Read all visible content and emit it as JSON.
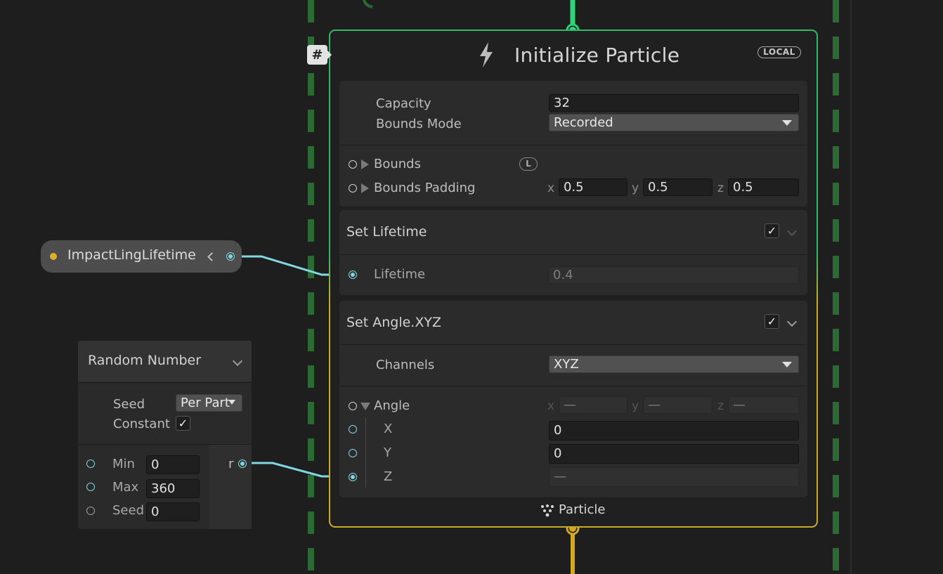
{
  "colors": {
    "background": "#1e1e1e",
    "spawn_flow_green": "#31b968",
    "particle_flow_yellow": "#c9ab2a",
    "wire_cyan": "#82d8e2"
  },
  "context_node": {
    "badge": "#",
    "icon": "lightning-bolt-icon",
    "title": "Initialize Particle",
    "space_badge": "LOCAL",
    "output_label": "Particle",
    "output_icon": "particle-icon"
  },
  "settings": {
    "capacity_label": "Capacity",
    "capacity_value": "32",
    "bounds_mode_label": "Bounds Mode",
    "bounds_mode_value": "Recorded",
    "bounds_label": "Bounds",
    "bounds_space_badge": "L",
    "bounds_padding_label": "Bounds Padding",
    "bounds_padding": {
      "x_label": "x",
      "x": "0.5",
      "y_label": "y",
      "y": "0.5",
      "z_label": "z",
      "z": "0.5"
    }
  },
  "blocks": {
    "set_lifetime": {
      "title": "Set Lifetime",
      "enabled": true,
      "checkmark": "✓",
      "lifetime_label": "Lifetime",
      "lifetime_value": "0.4"
    },
    "set_angle": {
      "title": "Set Angle.XYZ",
      "enabled": true,
      "checkmark": "✓",
      "channels_label": "Channels",
      "channels_value": "XYZ",
      "angle_label": "Angle",
      "angle_xyz": {
        "x_label": "x",
        "x": "—",
        "y_label": "y",
        "y": "—",
        "z_label": "z",
        "z": "—"
      },
      "x_label": "X",
      "x_value": "0",
      "y_label": "Y",
      "y_value": "0",
      "z_label": "Z",
      "z_value": "—"
    }
  },
  "property_node": {
    "name": "ImpactLingLifetime"
  },
  "random_node": {
    "title": "Random Number",
    "seed_label": "Seed",
    "seed_mode": "Per Part",
    "constant_label": "Constant",
    "constant_checked": true,
    "checkmark": "✓",
    "min_label": "Min",
    "min_value": "0",
    "max_label": "Max",
    "max_value": "360",
    "seed_in_label": "Seed",
    "seed_in_value": "0",
    "output_label": "r"
  }
}
